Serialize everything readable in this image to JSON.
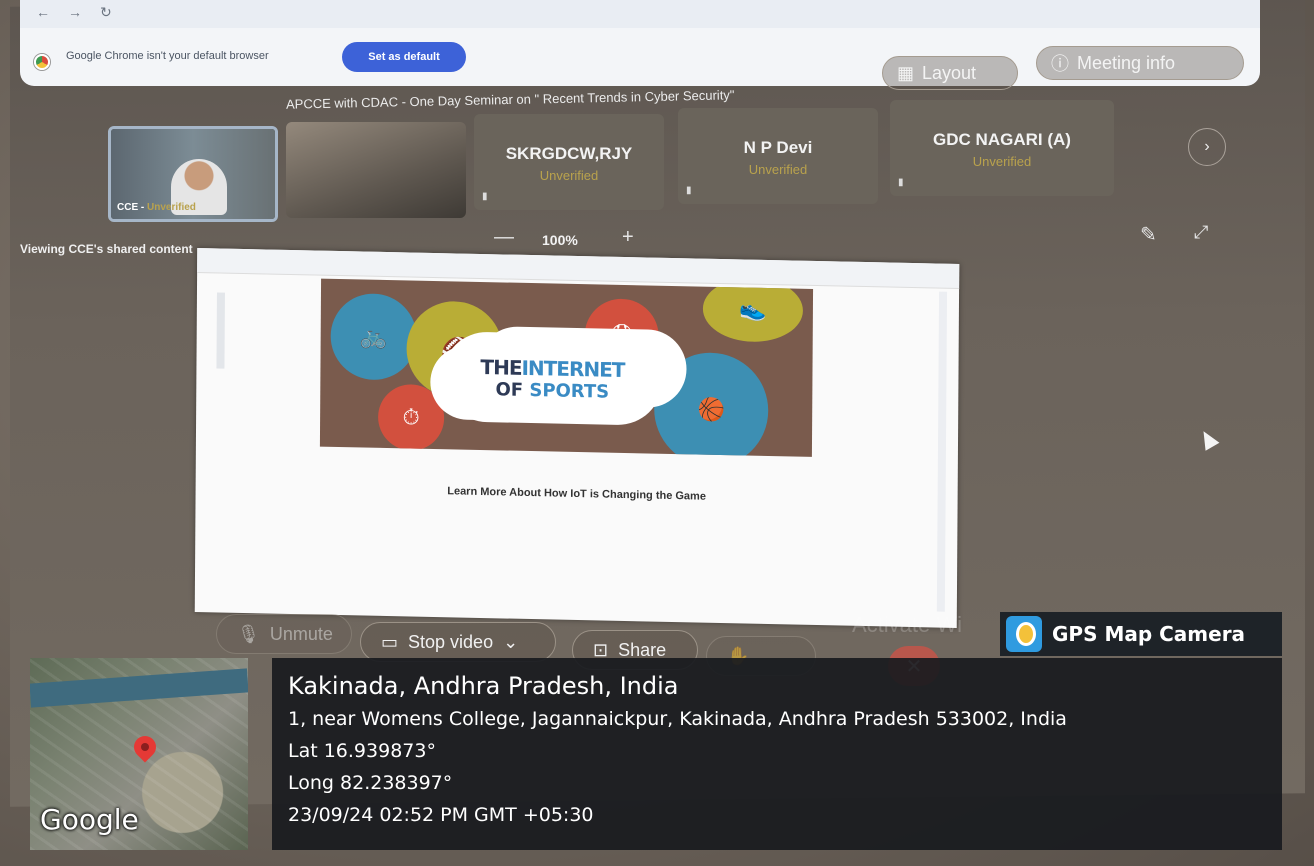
{
  "browser": {
    "default_browser_notice": "Google Chrome isn't your default browser",
    "set_default_button": "Set as default"
  },
  "meeting": {
    "title": "APCCE with CDAC - One Day Seminar on \" Recent Trends in Cyber Security\"",
    "layout_button": "Layout",
    "meeting_info_button": "Meeting info",
    "participants": [
      {
        "name": "CCE - ",
        "status": "Unverified"
      },
      {
        "name": "SKRGDCW,RJY",
        "status": "Unverified"
      },
      {
        "name": "N P Devi",
        "status": "Unverified"
      },
      {
        "name": "GDC NAGARI (A)",
        "status": "Unverified"
      }
    ],
    "viewing_label": "Viewing CCE's shared content",
    "zoom_level": "100%",
    "zoom_minus": "—",
    "zoom_plus": "+",
    "shared_slide": {
      "line1_a": "THE",
      "line1_b": "INTERNET",
      "line2_a": "OF",
      "line2_b": "SPORTS",
      "caption": "Learn More About How IoT is Changing the Game"
    },
    "controls": {
      "unmute": "Unmute",
      "stop_video": "Stop video",
      "share": "Share"
    },
    "activate_watermark": "Activate Wi"
  },
  "gps": {
    "app_name": "GPS Map Camera",
    "location_title": "Kakinada, Andhra Pradesh, India",
    "address": "1, near Womens College, Jagannaickpur, Kakinada, Andhra Pradesh 533002, India",
    "lat": "Lat 16.939873°",
    "long": "Long 82.238397°",
    "datetime": "23/09/24 02:52 PM GMT +05:30",
    "map_brand": "Google"
  },
  "colors": {
    "set_default_bg": "#3d62d8",
    "gps_panel_bg": "#181a1e",
    "map_pin": "#e53935",
    "end_call": "#b8574c"
  }
}
